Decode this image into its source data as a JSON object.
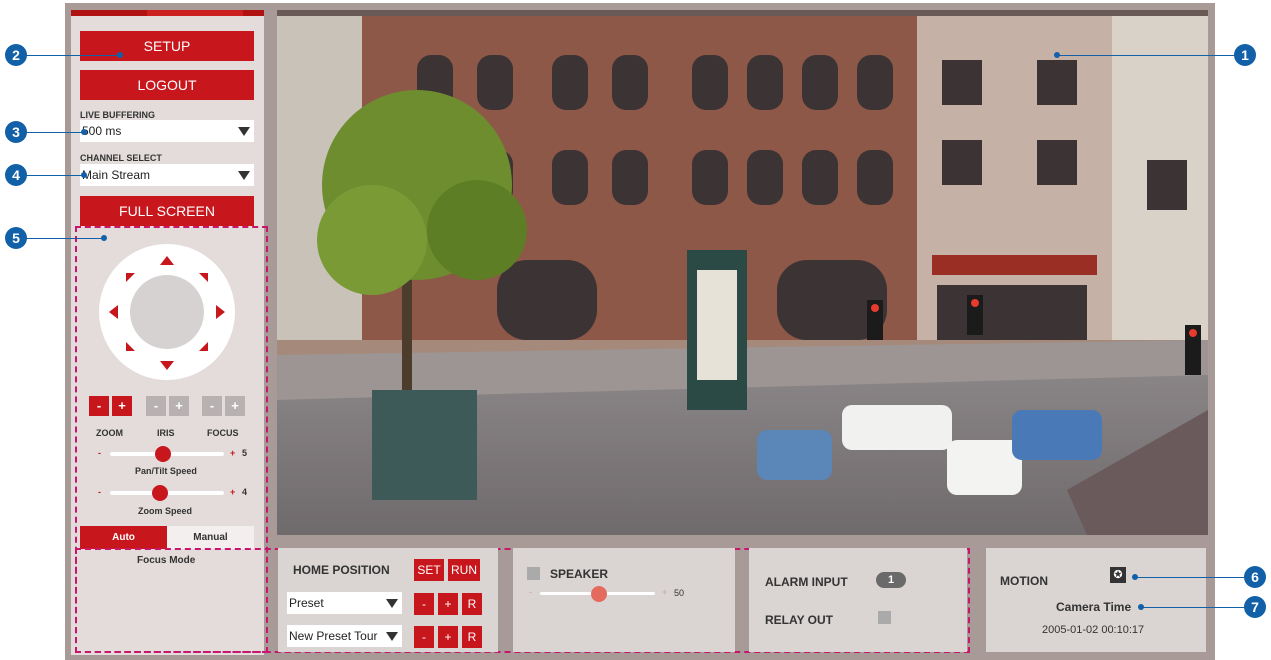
{
  "callouts": [
    "1",
    "2",
    "3",
    "4",
    "5",
    "6",
    "7"
  ],
  "left_panel": {
    "setup_label": "SETUP",
    "logout_label": "LOGOUT",
    "live_buffering_label": "LIVE BUFFERING",
    "live_buffering_value": "500 ms",
    "channel_select_label": "CHANNEL SELECT",
    "channel_select_value": "Main Stream",
    "fullscreen_label": "FULL SCREEN"
  },
  "ptz": {
    "minus": "-",
    "plus": "+",
    "zoom_label": "ZOOM",
    "iris_label": "IRIS",
    "focus_label": "FOCUS",
    "pan_tilt_speed_label": "Pan/Tilt Speed",
    "pan_tilt_speed_value": "5",
    "zoom_speed_label": "Zoom Speed",
    "zoom_speed_value": "4",
    "focus_auto_label": "Auto",
    "focus_manual_label": "Manual",
    "focus_mode_label": "Focus Mode"
  },
  "bottom": {
    "home_position_label": "HOME POSITION",
    "set_label": "SET",
    "run_label": "RUN",
    "preset_value": "Preset",
    "preset_tour_value": "New Preset Tour",
    "minus": "-",
    "plus": "+",
    "r_label": "R",
    "speaker_label": "SPEAKER",
    "speaker_min": "-",
    "speaker_plus": "+",
    "speaker_value": "50",
    "alarm_input_label": "ALARM INPUT",
    "alarm_input_value": "1",
    "relay_out_label": "RELAY OUT",
    "motion_label": "MOTION",
    "motion_icon": "running-person-icon",
    "camera_time_label": "Camera Time",
    "camera_time_value": "2005-01-02 00:10:17"
  },
  "colors": {
    "accent": "#c8161d",
    "callout": "#1160a8",
    "dashed_outline": "#c8166e",
    "panel_bg": "#e3dcdb",
    "frame_bg": "#a89a97"
  }
}
